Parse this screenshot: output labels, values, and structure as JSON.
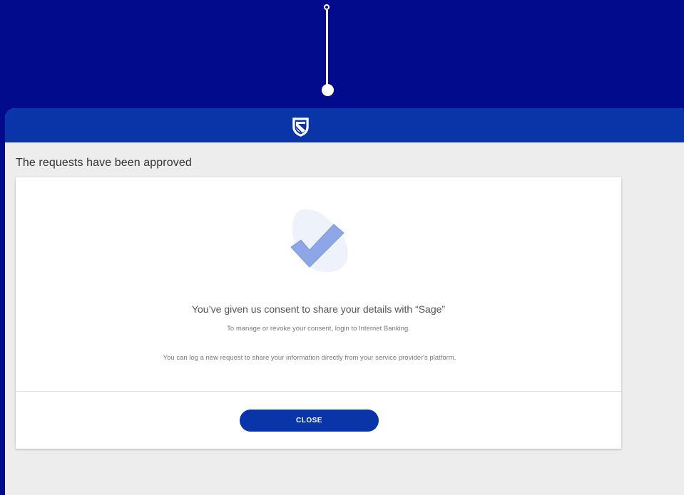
{
  "colors": {
    "background": "#020b8c",
    "header": "#0a35a8",
    "window": "#ededed",
    "card": "#ffffff",
    "button": "#0a35a8",
    "check": "#8ca6e6"
  },
  "header": {
    "logo_icon": "bank-shield-logo-icon"
  },
  "page": {
    "title": "The requests have been approved"
  },
  "card": {
    "illustration_icon": "checkmark-icon",
    "heading": "You’ve given us consent to share your details with “Sage”",
    "manage_text": "To manage or revoke your consent, login to Internet Banking.",
    "info_text": "You can log a new request to share your information directly from your service provider's platform.",
    "close_label": "CLOSE"
  }
}
